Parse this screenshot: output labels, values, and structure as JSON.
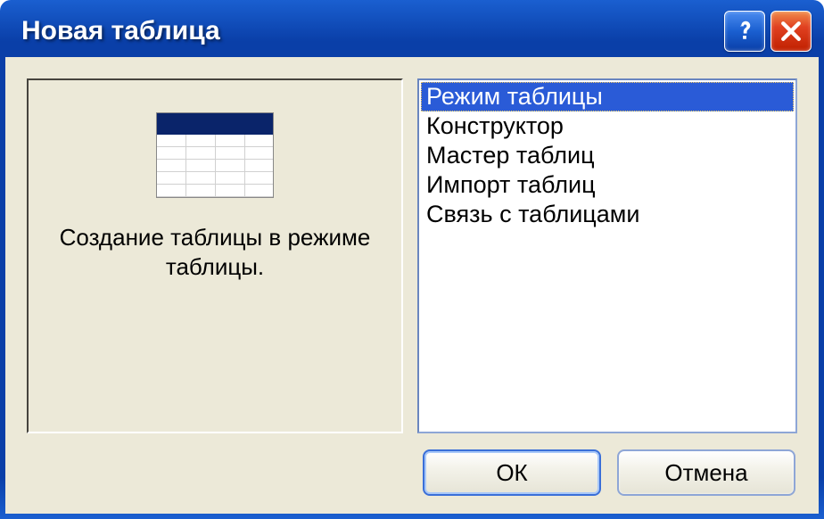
{
  "window": {
    "title": "Новая таблица"
  },
  "preview": {
    "description": "Создание таблицы в режиме таблицы."
  },
  "list": {
    "items": [
      "Режим таблицы",
      "Конструктор",
      "Мастер таблиц",
      "Импорт таблиц",
      "Связь с таблицами"
    ],
    "selected_index": 0
  },
  "buttons": {
    "ok": "ОК",
    "cancel": "Отмена"
  }
}
